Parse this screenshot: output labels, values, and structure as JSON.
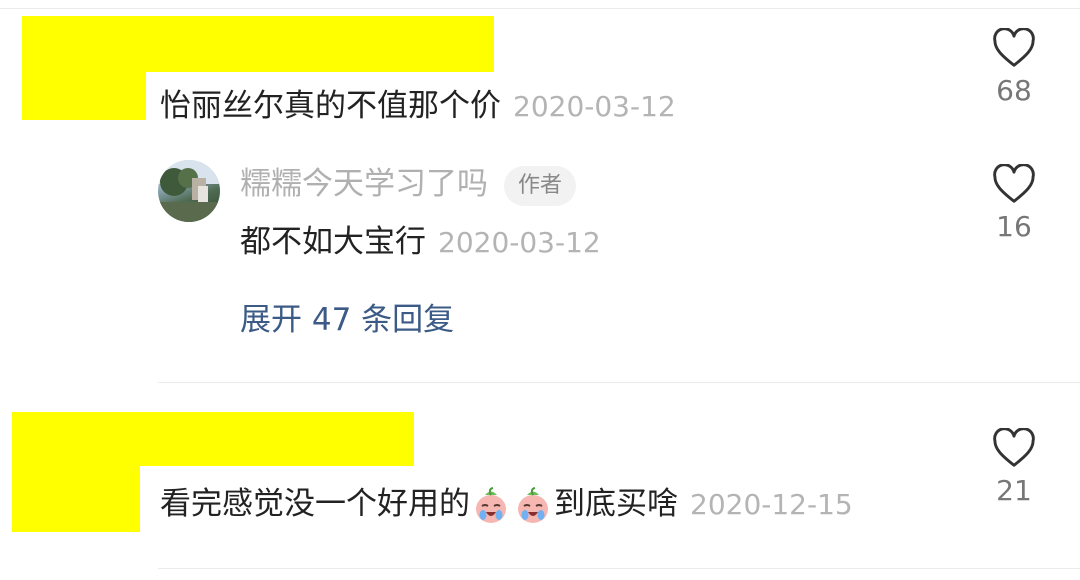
{
  "comments": [
    {
      "text": "怡丽丝尔真的不值那个价",
      "date": "2020-03-12",
      "likes": "68",
      "reply": {
        "username": "糯糯今天学习了吗",
        "badge": "作者",
        "text": "都不如大宝行",
        "date": "2020-03-12",
        "likes": "16"
      },
      "expand_label": "展开 47 条回复"
    },
    {
      "text_before": "看完感觉没一个好用的",
      "emoji": [
        "crying-peach-emoji",
        "crying-peach-emoji"
      ],
      "text_after": "到底买啥",
      "date": "2020-12-15",
      "likes": "21"
    }
  ],
  "colors": {
    "redaction": "#ffff00",
    "link": "#3c5a86",
    "date": "#b4b4b4"
  }
}
